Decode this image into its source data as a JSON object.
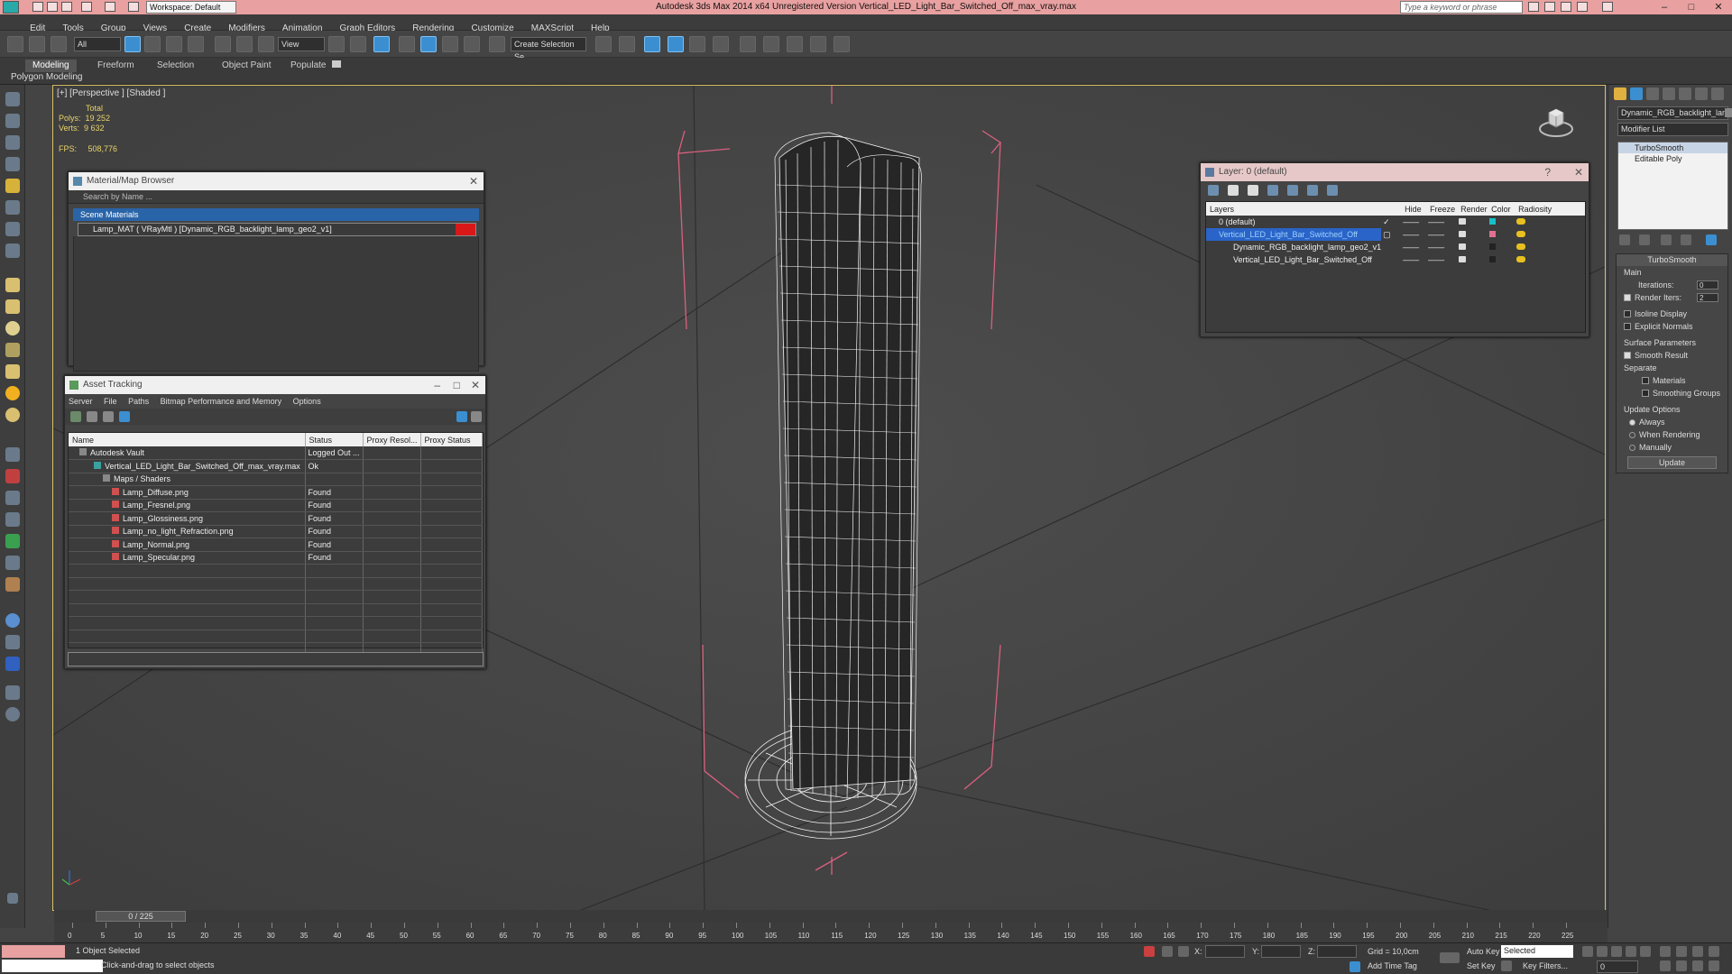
{
  "titlebar": {
    "title": "Autodesk 3ds Max  2014 x64    Unregistered Version    Vertical_LED_Light_Bar_Switched_Off_max_vray.max",
    "workspace": "Workspace: Default",
    "search_placeholder": "Type a keyword or phrase",
    "minimize": "–",
    "maximize": "□",
    "close": "✕"
  },
  "menu": [
    "Edit",
    "Tools",
    "Group",
    "Views",
    "Create",
    "Modifiers",
    "Animation",
    "Graph Editors",
    "Rendering",
    "Customize",
    "MAXScript",
    "Help"
  ],
  "toolbar": {
    "selection_filter": "All",
    "ref_coord": "View",
    "named_sel": "Create Selection Se"
  },
  "ribbon": {
    "tabs": [
      "Modeling",
      "Freeform",
      "Selection",
      "Object Paint",
      "Populate"
    ],
    "sub_label": "Polygon Modeling"
  },
  "viewport": {
    "label": "[+] [Perspective ] [Shaded ]",
    "stats": {
      "total_label": "Total",
      "polys_label": "Polys:",
      "polys": "19 252",
      "verts_label": "Verts:",
      "verts": "9 632",
      "fps_label": "FPS:",
      "fps": "508,776"
    }
  },
  "material_browser": {
    "title": "Material/Map Browser",
    "search_placeholder": "Search by Name ...",
    "category": "Scene Materials",
    "item": "Lamp_MAT  ( VRayMtl )  [Dynamic_RGB_backlight_lamp_geo2_v1]",
    "swatch_color": "#d81818"
  },
  "asset_tracking": {
    "title": "Asset Tracking",
    "menu": [
      "Server",
      "File",
      "Paths",
      "Bitmap Performance and Memory",
      "Options"
    ],
    "columns": [
      "Name",
      "Status",
      "Proxy Resol...",
      "Proxy Status"
    ],
    "rows": [
      {
        "name": "Autodesk Vault",
        "status": "Logged Out ..."
      },
      {
        "name": "Vertical_LED_Light_Bar_Switched_Off_max_vray.max",
        "status": "Ok"
      },
      {
        "name": "Maps / Shaders",
        "status": ""
      },
      {
        "name": "Lamp_Diffuse.png",
        "status": "Found"
      },
      {
        "name": "Lamp_Fresnel.png",
        "status": "Found"
      },
      {
        "name": "Lamp_Glossiness.png",
        "status": "Found"
      },
      {
        "name": "Lamp_no_light_Refraction.png",
        "status": "Found"
      },
      {
        "name": "Lamp_Normal.png",
        "status": "Found"
      },
      {
        "name": "Lamp_Specular.png",
        "status": "Found"
      }
    ]
  },
  "layer_window": {
    "title": "Layer: 0 (default)",
    "help": "?",
    "close": "✕",
    "columns": [
      "Layers",
      "",
      "Hide",
      "Freeze",
      "Render",
      "Color",
      "Radiosity"
    ],
    "rows": [
      {
        "name": "0 (default)",
        "color": "#17c0c8"
      },
      {
        "name": "Vertical_LED_Light_Bar_Switched_Off",
        "color": "#e07090"
      },
      {
        "name": "Dynamic_RGB_backlight_lamp_geo2_v1",
        "color": "#222222"
      },
      {
        "name": "Vertical_LED_Light_Bar_Switched_Off",
        "color": "#222222"
      }
    ],
    "dash": "——"
  },
  "command_panel": {
    "object_name": "Dynamic_RGB_backlight_lamp",
    "modifier_list": "Modifier List",
    "stack": [
      "TurboSmooth",
      "Editable Poly"
    ],
    "turbosmooth": {
      "title": "TurboSmooth",
      "main": "Main",
      "iterations_label": "Iterations:",
      "iterations": "0",
      "render_iters_label": "Render Iters:",
      "render_iters": "2",
      "isoline": "Isoline Display",
      "explicit_normals": "Explicit Normals",
      "surface_params": "Surface Parameters",
      "smooth_result": "Smooth Result",
      "separate": "Separate",
      "materials": "Materials",
      "smoothing_groups": "Smoothing Groups",
      "update_options": "Update Options",
      "always": "Always",
      "when_rendering": "When Rendering",
      "manually": "Manually",
      "update_button": "Update"
    }
  },
  "timeline": {
    "frame_display": "0 / 225",
    "ticks": [
      "0",
      "5",
      "10",
      "15",
      "20",
      "25",
      "30",
      "35",
      "40",
      "45",
      "50",
      "55",
      "60",
      "65",
      "70",
      "75",
      "80",
      "85",
      "90",
      "95",
      "100",
      "105",
      "110",
      "115",
      "120",
      "125",
      "130",
      "135",
      "140",
      "145",
      "150",
      "155",
      "160",
      "165",
      "170",
      "175",
      "180",
      "185",
      "190",
      "195",
      "200",
      "205",
      "210",
      "215",
      "220",
      "225"
    ]
  },
  "status": {
    "selection": "1 Object Selected",
    "prompt": "Click-and-drag to select objects",
    "x_label": "X:",
    "y_label": "Y:",
    "z_label": "Z:",
    "grid": "Grid = 10,0cm",
    "add_time_tag": "Add Time Tag",
    "auto_key": "Auto Key",
    "set_key": "Set Key",
    "selected": "Selected",
    "key_filters": "Key Filters...",
    "frame": "0"
  }
}
